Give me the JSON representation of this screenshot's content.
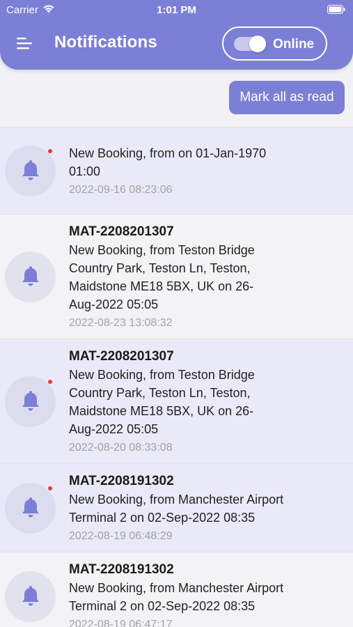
{
  "status_bar": {
    "carrier": "Carrier",
    "time": "1:01 PM"
  },
  "header": {
    "title": "Notifications",
    "online_label": "Online",
    "online_on": true
  },
  "actions": {
    "mark_all_read": "Mark all as read"
  },
  "colors": {
    "accent": "#7b7fd6",
    "unread_bg": "#e9e9f8",
    "read_bg": "#f3f3f5",
    "badge": "#e53b3b"
  },
  "notifications": [
    {
      "ref": "",
      "msg_lines": [
        "New Booking, from  on 01-Jan-1970",
        "01:00"
      ],
      "date": "2022-09-16 08:23:06",
      "unread": true
    },
    {
      "ref": "MAT-2208201307",
      "msg_lines": [
        "New Booking, from Teston Bridge",
        "Country Park, Teston Ln, Teston,",
        "Maidstone ME18 5BX, UK on 26-",
        "Aug-2022 05:05"
      ],
      "date": "2022-08-23 13:08:32",
      "unread": false
    },
    {
      "ref": "MAT-2208201307",
      "msg_lines": [
        "New Booking, from Teston Bridge",
        "Country Park, Teston Ln, Teston,",
        "Maidstone ME18 5BX, UK on 26-",
        "Aug-2022 05:05"
      ],
      "date": "2022-08-20 08:33:08",
      "unread": true
    },
    {
      "ref": "MAT-2208191302",
      "msg_lines": [
        "New Booking, from Manchester Airport",
        "Terminal 2 on 02-Sep-2022 08:35"
      ],
      "date": "2022-08-19 06:48:29",
      "unread": true
    },
    {
      "ref": "MAT-2208191302",
      "msg_lines": [
        "New Booking, from Manchester Airport",
        "Terminal 2 on 02-Sep-2022 08:35"
      ],
      "date": "2022-08-19 06:47:17",
      "unread": false
    }
  ]
}
